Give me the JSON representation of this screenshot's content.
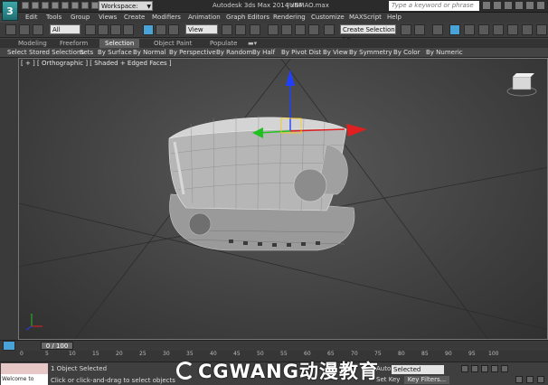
{
  "titlebar": {
    "app_logo": "3",
    "workspace": "Workspace: Default",
    "title": "Autodesk 3ds Max  2014 x64",
    "file": "JUNMAO.max",
    "search_placeholder": "Type a keyword or phrase"
  },
  "menu": [
    "Edit",
    "Tools",
    "Group",
    "Views",
    "Create",
    "Modifiers",
    "Animation",
    "Graph Editors",
    "Rendering",
    "Customize",
    "MAXScript",
    "Help"
  ],
  "toolbar": {
    "filter_value": "All",
    "refcoord_value": "View",
    "selection_set_value": "Create Selection Se"
  },
  "ribbon": {
    "tabs": [
      "Modeling",
      "Freeform",
      "Selection",
      "Object Paint",
      "Populate"
    ],
    "selected_tab": "Selection",
    "row": [
      "Select",
      "Stored Selections",
      "Sets",
      "By Surface",
      "By Normal",
      "By Perspective",
      "By Random",
      "By Half",
      "By Pivot Dist",
      "By View",
      "By Symmetry",
      "By Color",
      "By Numeric"
    ]
  },
  "viewport": {
    "label": "[ + ] [ Orthographic ] [ Shaded + Edged Faces ]",
    "background": "#4a4a4a",
    "gizmo_colors": {
      "x": "#e02020",
      "y": "#20c020",
      "z": "#2040ff"
    }
  },
  "timeline": {
    "position": "0 / 100",
    "ticks": [
      "0",
      "5",
      "10",
      "15",
      "20",
      "25",
      "30",
      "35",
      "40",
      "45",
      "50",
      "55",
      "60",
      "65",
      "70",
      "75",
      "80",
      "85",
      "90",
      "95",
      "100"
    ]
  },
  "status": {
    "maxscript": "Welcome to MAXS",
    "selection": "1 Object Selected",
    "prompt": "Click or click-and-drag to select objects",
    "autokey": "Auto Key",
    "setkey": "Set Key",
    "key_mode": "Selected",
    "key_filters": "Key Filters..."
  },
  "watermark": "CGWANG动漫教育"
}
